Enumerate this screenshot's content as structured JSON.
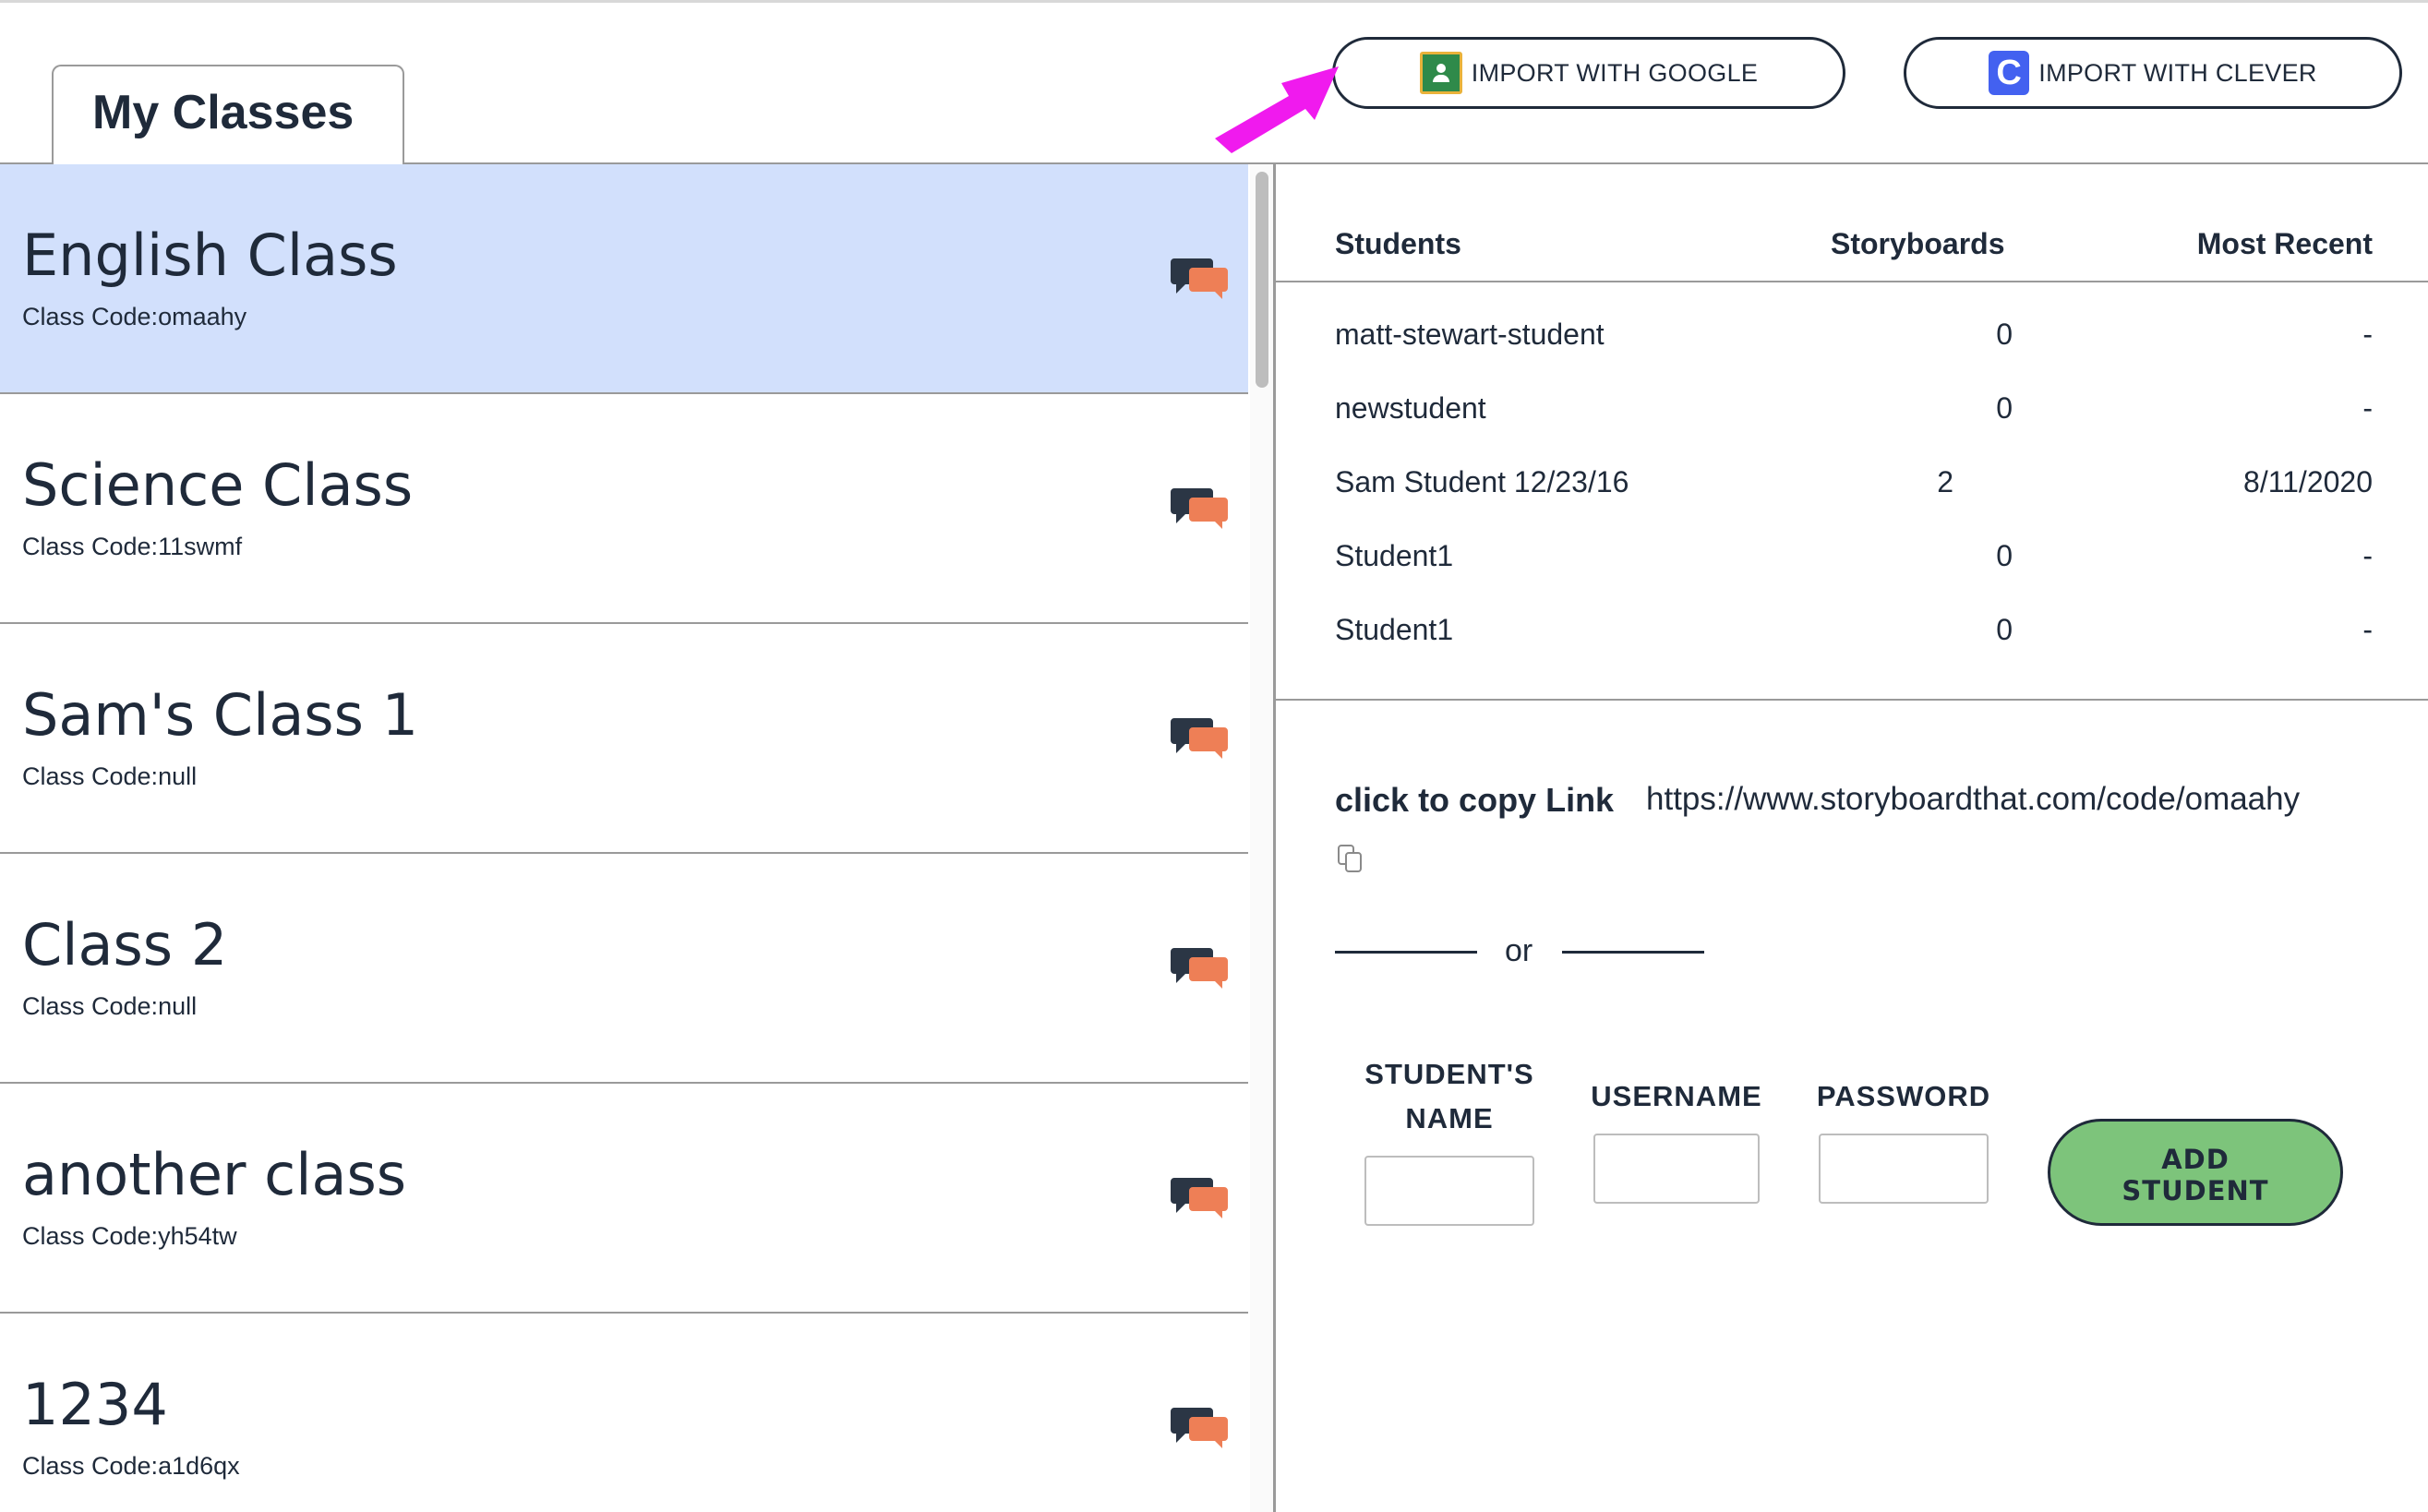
{
  "header": {
    "tab_title": "My Classes",
    "import_google_label": "IMPORT WITH GOOGLE",
    "import_clever_label": "IMPORT WITH CLEVER"
  },
  "colors": {
    "selected_row": "#d2e0fc",
    "arrow": "#f01aee",
    "add_button": "#7dc47b",
    "text": "#1f2a3a",
    "chat_dark": "#2b3645",
    "chat_orange": "#ee7f56"
  },
  "classes": [
    {
      "name": "English Class",
      "code": "Class Code:omaahy",
      "selected": true
    },
    {
      "name": "Science Class",
      "code": "Class Code:11swmf",
      "selected": false
    },
    {
      "name": "Sam's Class 1",
      "code": "Class Code:null",
      "selected": false
    },
    {
      "name": "Class 2",
      "code": "Class Code:null",
      "selected": false
    },
    {
      "name": "another class",
      "code": "Class Code:yh54tw",
      "selected": false
    },
    {
      "name": "1234",
      "code": "Class Code:a1d6qx",
      "selected": false
    }
  ],
  "students_table": {
    "headers": {
      "students": "Students",
      "storyboards": "Storyboards",
      "most_recent": "Most Recent"
    },
    "rows": [
      {
        "name": "matt-stewart-student",
        "storyboards": "0",
        "most_recent": "-"
      },
      {
        "name": "newstudent",
        "storyboards": "0",
        "most_recent": "-"
      },
      {
        "name": "Sam Student 12/23/16",
        "storyboards": "2",
        "most_recent": "8/11/2020"
      },
      {
        "name": "Student1",
        "storyboards": "0",
        "most_recent": "-"
      },
      {
        "name": "Student1",
        "storyboards": "0",
        "most_recent": "-"
      }
    ]
  },
  "copy_link": {
    "label": "click to copy Link",
    "url": "https://www.storyboardthat.com/code/omaahy"
  },
  "divider_text": "or",
  "add_student_form": {
    "name_label_line1": "STUDENT'S",
    "name_label_line2": "NAME",
    "username_label": "USERNAME",
    "password_label": "PASSWORD",
    "name_value": "",
    "username_value": "",
    "password_value": "",
    "button_line1": "ADD",
    "button_line2": "STUDENT"
  },
  "icons": {
    "google_classroom": "google-classroom-icon",
    "clever": "clever-icon",
    "chat": "chat-bubbles-icon",
    "copy": "copy-icon",
    "arrow": "pointer-arrow"
  },
  "clever_icon_letter": "C"
}
